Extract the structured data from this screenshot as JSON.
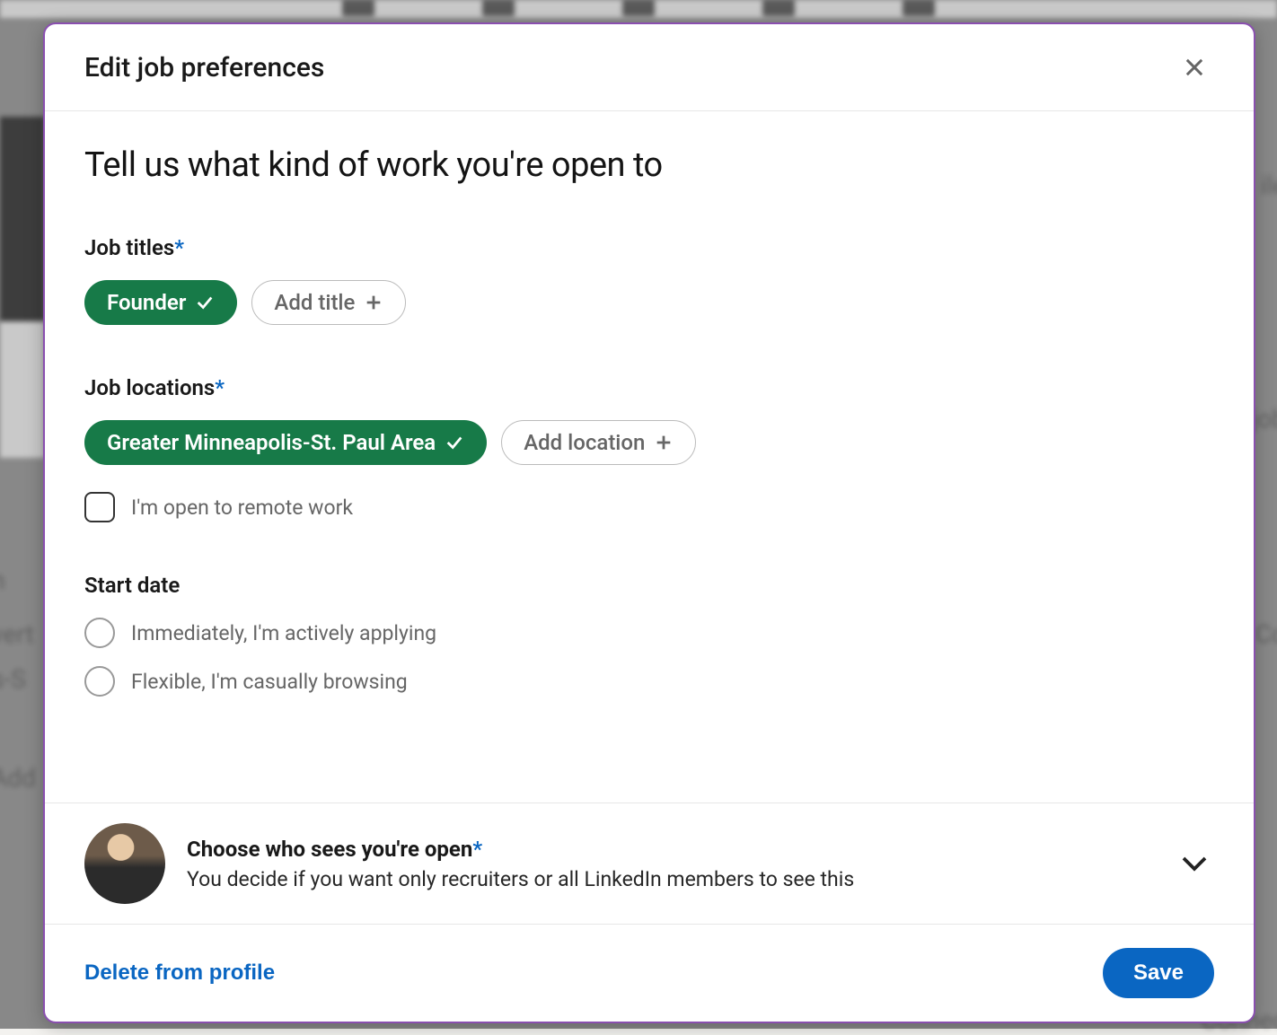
{
  "modal": {
    "title": "Edit job preferences",
    "headline": "Tell us what kind of work you're open to"
  },
  "jobTitles": {
    "label": "Job titles",
    "required": "*",
    "selected": [
      "Founder"
    ],
    "addLabel": "Add title"
  },
  "jobLocations": {
    "label": "Job locations",
    "required": "*",
    "selected": [
      "Greater Minneapolis-St. Paul Area"
    ],
    "addLabel": "Add location",
    "remoteCheckbox": "I'm open to remote work",
    "remoteChecked": false
  },
  "startDate": {
    "label": "Start date",
    "options": [
      {
        "label": "Immediately, I'm actively applying",
        "selected": false
      },
      {
        "label": "Flexible, I'm casually browsing",
        "selected": false
      }
    ]
  },
  "visibility": {
    "title": "Choose who sees you're open",
    "required": "*",
    "subtitle": "You decide if you want only recruiters or all LinkedIn members to see this"
  },
  "footer": {
    "deleteLabel": "Delete from profile",
    "saveLabel": "Save"
  },
  "colors": {
    "selectedPill": "#177a48",
    "primaryBlue": "#0a66c2"
  }
}
